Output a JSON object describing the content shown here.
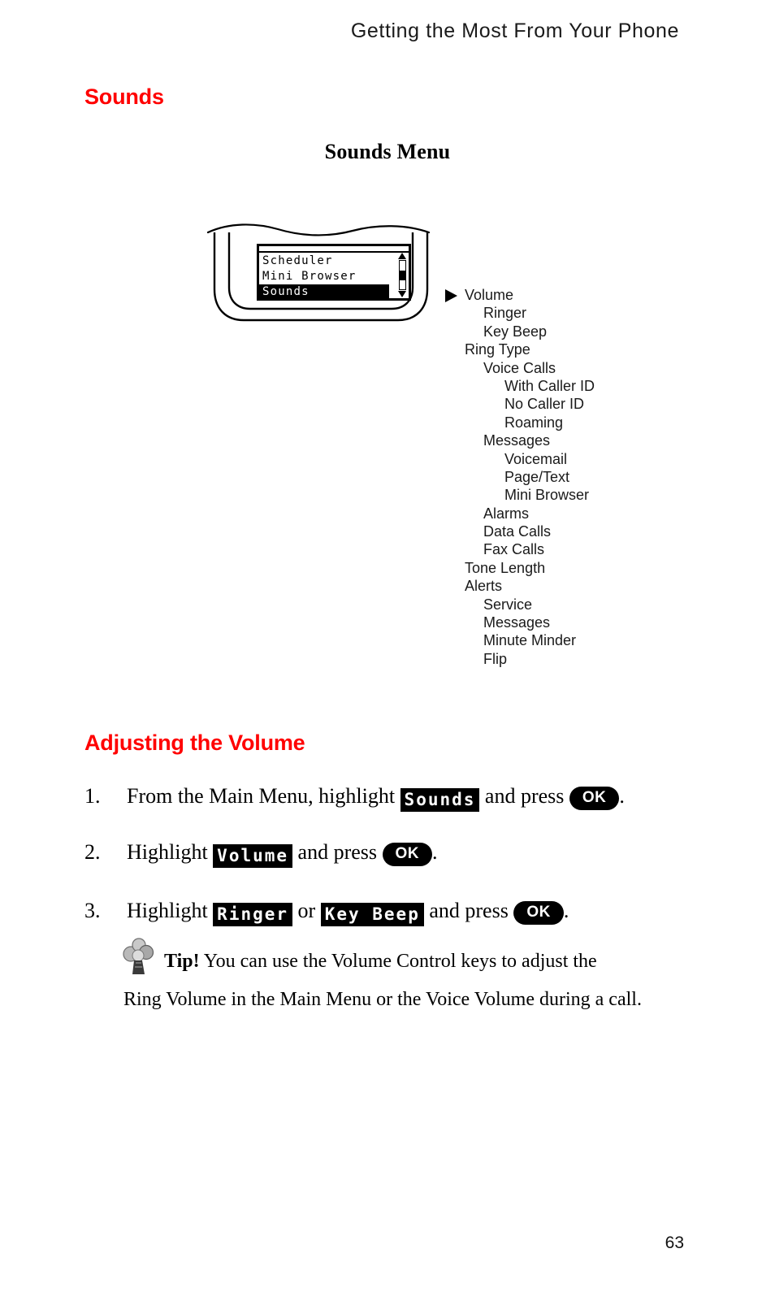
{
  "page": {
    "running_header": "Getting the Most From Your Phone",
    "page_number": "63",
    "accent_color": "#ff0000"
  },
  "sections": {
    "sounds_heading": "Sounds",
    "volume_heading": "Adjusting the Volume"
  },
  "figure": {
    "title": "Sounds Menu",
    "phone_screen": {
      "rows": [
        {
          "label": "Scheduler",
          "selected": false
        },
        {
          "label": "Mini Browser",
          "selected": false
        },
        {
          "label": "Sounds",
          "selected": true
        }
      ],
      "scrollbar": {
        "up_arrow": "scroll-up-arrow",
        "down_arrow": "scroll-down-arrow"
      }
    },
    "pointer_icon": "right-triangle-pointer",
    "menu_tree": [
      {
        "label": "Volume",
        "level": 0,
        "pointer": true
      },
      {
        "label": "Ringer",
        "level": 1,
        "pointer": false
      },
      {
        "label": "Key Beep",
        "level": 1,
        "pointer": false
      },
      {
        "label": "Ring Type",
        "level": 0,
        "pointer": false
      },
      {
        "label": "Voice Calls",
        "level": 1,
        "pointer": false
      },
      {
        "label": "With Caller ID",
        "level": 2,
        "pointer": false
      },
      {
        "label": "No Caller ID",
        "level": 2,
        "pointer": false
      },
      {
        "label": "Roaming",
        "level": 2,
        "pointer": false
      },
      {
        "label": "Messages",
        "level": 1,
        "pointer": false
      },
      {
        "label": "Voicemail",
        "level": 2,
        "pointer": false
      },
      {
        "label": "Page/Text",
        "level": 2,
        "pointer": false
      },
      {
        "label": "Mini Browser",
        "level": 2,
        "pointer": false
      },
      {
        "label": "Alarms",
        "level": 1,
        "pointer": false
      },
      {
        "label": "Data Calls",
        "level": 1,
        "pointer": false
      },
      {
        "label": "Fax Calls",
        "level": 1,
        "pointer": false
      },
      {
        "label": "Tone Length",
        "level": 0,
        "pointer": false
      },
      {
        "label": "Alerts",
        "level": 0,
        "pointer": false
      },
      {
        "label": "Service",
        "level": 1,
        "pointer": false
      },
      {
        "label": "Messages",
        "level": 1,
        "pointer": false
      },
      {
        "label": "Minute Minder",
        "level": 1,
        "pointer": false
      },
      {
        "label": "Flip",
        "level": 1,
        "pointer": false
      }
    ]
  },
  "steps": [
    {
      "number": "1.",
      "before": "From the Main Menu, highlight ",
      "chip1": "Sounds",
      "middle": " and press ",
      "key": "OK",
      "after": "."
    },
    {
      "number": "2.",
      "before": "Highlight ",
      "chip1": "Volume",
      "middle": " and press ",
      "key": "OK",
      "after": "."
    },
    {
      "number": "3.",
      "before": "Highlight ",
      "chip1": "Ringer",
      "conjunction": " or ",
      "chip2": "Key Beep",
      "middle": " and press ",
      "key": "OK",
      "after": "."
    }
  ],
  "tip": {
    "icon": "tip-idea-icon",
    "label": "Tip!",
    "line1": " You can use the Volume Control keys to adjust the",
    "line2": "Ring Volume in the Main Menu or the Voice Volume during a call."
  }
}
